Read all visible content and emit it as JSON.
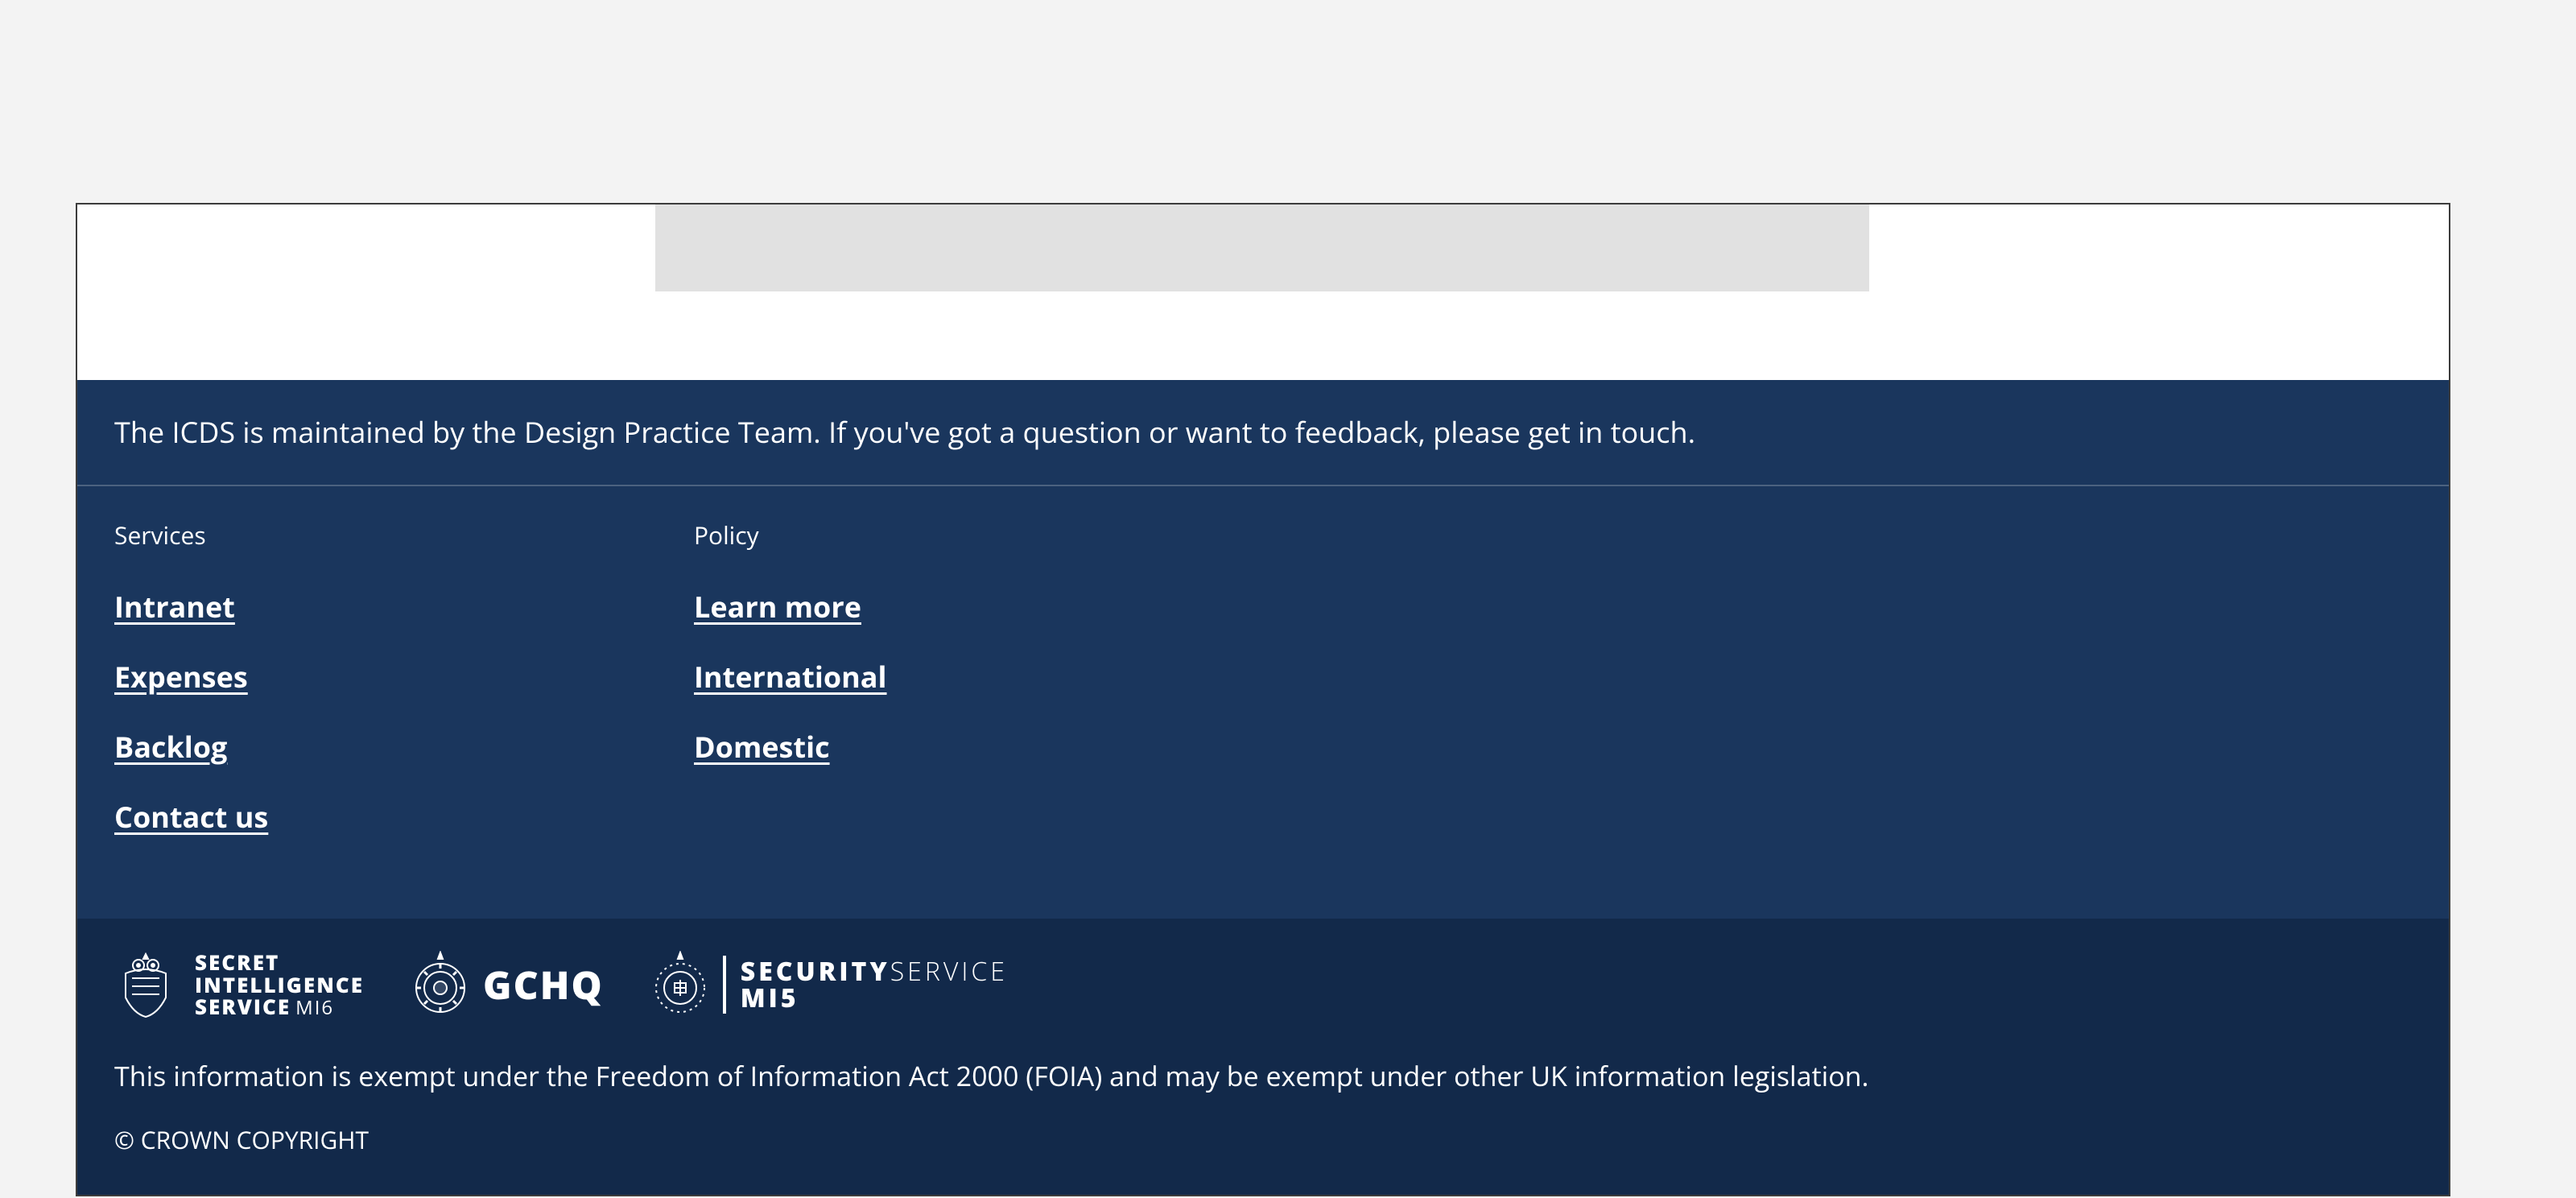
{
  "footer": {
    "intro": "The ICDS is maintained by the Design Practice Team. If you've got a question or want to feedback, please get in touch.",
    "columns": [
      {
        "title": "Services",
        "links": [
          "Intranet",
          "Expenses",
          "Backlog",
          "Contact us"
        ]
      },
      {
        "title": "Policy",
        "links": [
          "Learn more",
          "International",
          "Domestic"
        ]
      }
    ],
    "logos": {
      "mi6": {
        "line1": "SECRET",
        "line2": "INTELLIGENCE",
        "line3_bold": "SERVICE",
        "line3_thin": "MI6"
      },
      "gchq": {
        "word": "GCHQ"
      },
      "mi5": {
        "line1_bold": "SECURITY",
        "line1_thin": "SERVICE",
        "line2": "MI5"
      }
    },
    "foia": "This information is exempt under the Freedom of Information Act 2000 (FOIA) and may be exempt under other UK information legislation.",
    "copyright": "© CROWN COPYRIGHT"
  }
}
